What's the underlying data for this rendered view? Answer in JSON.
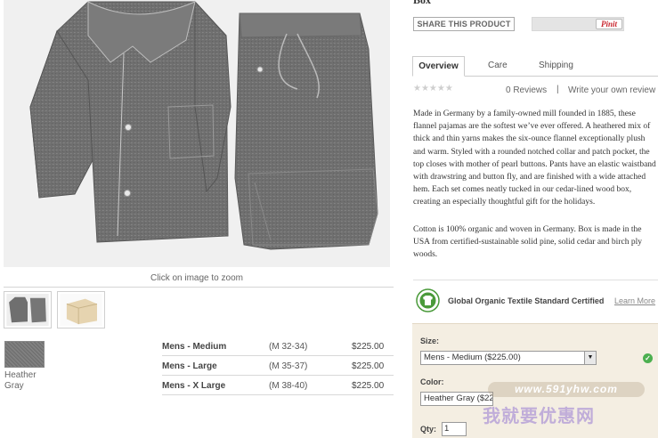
{
  "product": {
    "title": "Box",
    "zoom_caption": "Click on image to zoom",
    "thumbnails": [
      {
        "icon": "pajama-set-thumbnail"
      },
      {
        "icon": "wood-box-thumbnail"
      }
    ]
  },
  "swatch": {
    "label": "Heather Gray",
    "color": "#777777"
  },
  "sizes": [
    {
      "name": "Mens - Medium",
      "range": "(M 32-34)",
      "price": "$225.00"
    },
    {
      "name": "Mens - Large",
      "range": "(M 35-37)",
      "price": "$225.00"
    },
    {
      "name": "Mens - X Large",
      "range": "(M 38-40)",
      "price": "$225.00"
    }
  ],
  "share": {
    "label": "SHARE THIS PRODUCT",
    "pinit": "Pinit"
  },
  "tabs": [
    {
      "label": "Overview",
      "active": true
    },
    {
      "label": "Care",
      "active": false
    },
    {
      "label": "Shipping",
      "active": false
    }
  ],
  "reviews": {
    "stars": "★★★★★",
    "rating": 0,
    "count_label": "0 Reviews",
    "separator": "|",
    "write_label": "Write your own review"
  },
  "description": [
    "Made in Germany by a family-owned mill founded in 1885, these flannel pajamas are the softest we’ve ever offered. A heathered mix of thick and thin yarns makes the six-ounce flannel exceptionally plush and warm. Styled with a rounded notched collar and patch pocket, the top closes with mother of pearl buttons. Pants have an elastic waistband with drawstring and button fly, and are finished with a wide attached hem. Each set comes neatly tucked in our cedar-lined wood box, creating an especially thoughtful gift for the holidays.",
    "Cotton is 100% organic and woven in Germany. Box is made in the USA from certified-sustainable solid pine, solid cedar and birch ply woods."
  ],
  "certification": {
    "label": "Global Organic Textile Standard Certified",
    "link": "Learn More",
    "icon": "gots-logo-icon",
    "color": "#4a9a3a"
  },
  "options": {
    "size_label": "Size:",
    "size_value": "Mens - Medium ($225.00)",
    "color_label": "Color:",
    "color_value": "Heather Gray ($225.00)",
    "qty_label": "Qty:",
    "qty_value": "1",
    "panel_color": "#f4eee2",
    "check_color": "#4caf50"
  },
  "watermark": {
    "url": "www.591yhw.com",
    "text": "我就要优惠网"
  }
}
